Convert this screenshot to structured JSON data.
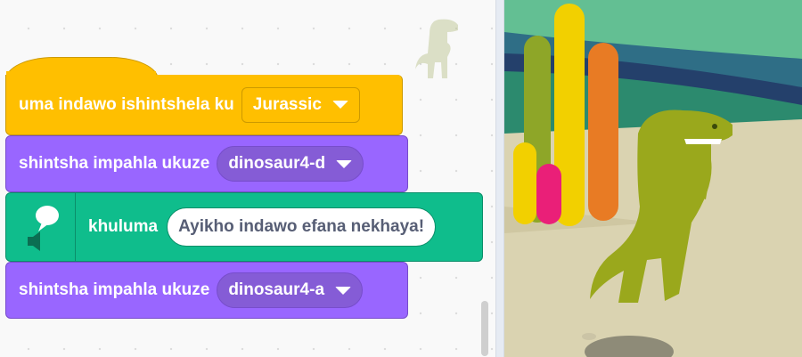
{
  "blocks": {
    "switch_backdrop": {
      "text": "uma indawo ishintshela ku",
      "value": "Jurassic"
    },
    "switch_costume_1": {
      "text": "shintsha impahla ukuze",
      "value": "dinosaur4-d"
    },
    "say": {
      "text": "khuluma",
      "value": "Ayikho indawo efana nekhaya!"
    },
    "switch_costume_2": {
      "text": "shintsha impahla ukuze",
      "value": "dinosaur4-a"
    }
  },
  "icons": {
    "extension": "speech-speaker-icon",
    "dropdown": "caret-down-icon",
    "sprite": "dinosaur-sprite-icon"
  },
  "colors": {
    "events": "#ffbf00",
    "looks": "#9966ff",
    "text_to_speech": "#0fbd8c",
    "stage_sky": "#63bf93",
    "stage_ground": "#dad3b1",
    "dino": "#9aa81c"
  }
}
